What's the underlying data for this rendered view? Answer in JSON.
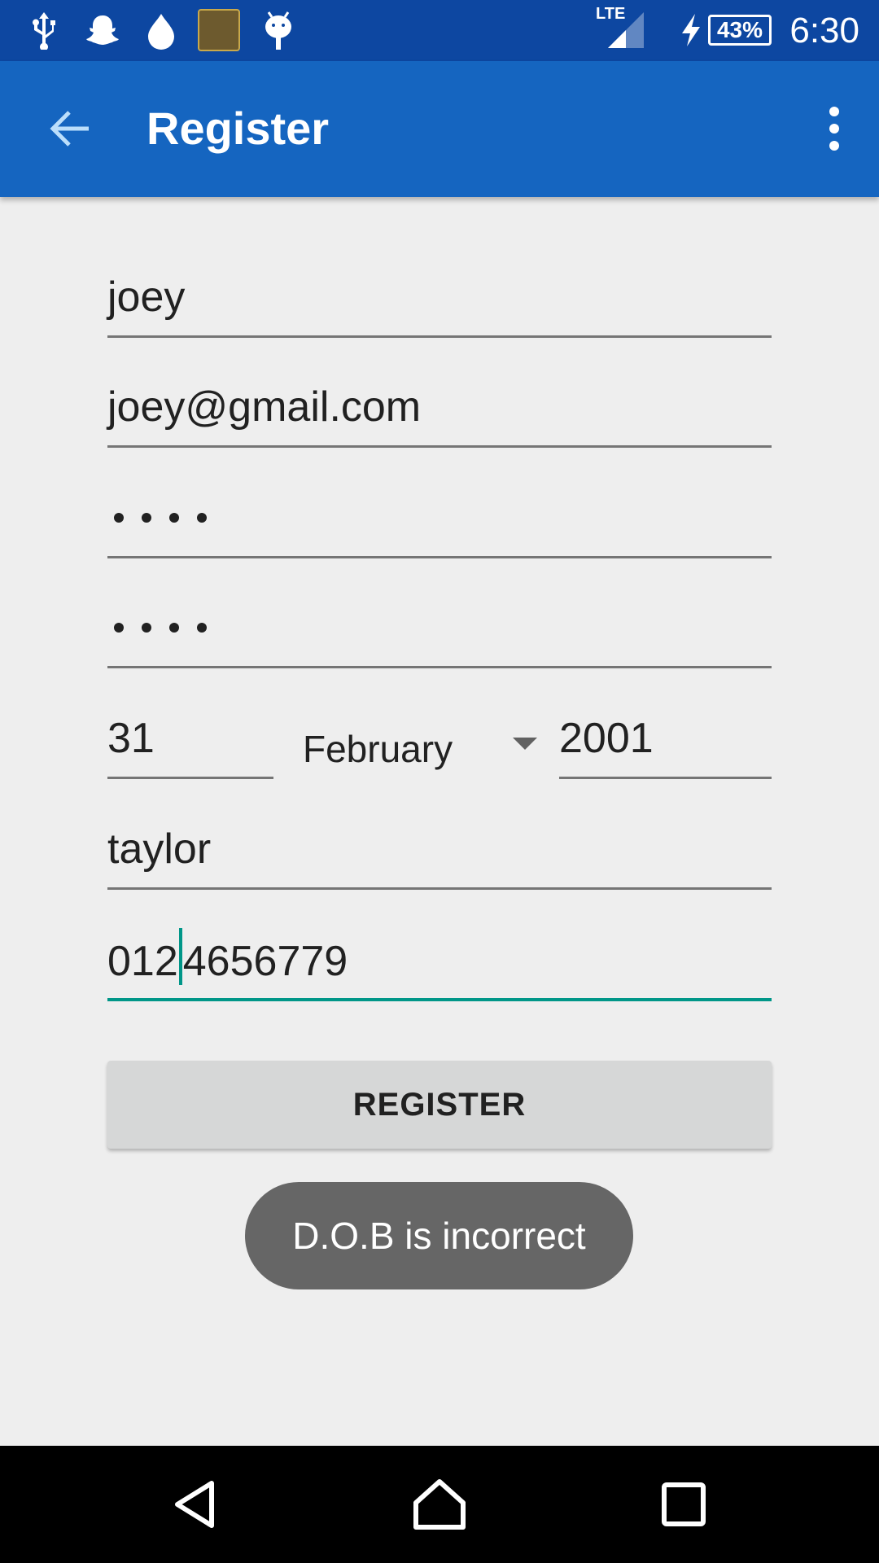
{
  "status_bar": {
    "time": "6:30",
    "battery": "43%",
    "network": "LTE",
    "icons": [
      "usb-icon",
      "snapchat-icon",
      "drop-icon",
      "game-app-icon",
      "android-debug-icon",
      "signal-icon",
      "charging-icon",
      "battery-icon"
    ]
  },
  "app_bar": {
    "title": "Register",
    "back_icon": "arrow-back-icon",
    "menu_icon": "overflow-menu-icon"
  },
  "form": {
    "name": "joey",
    "email": "joey@gmail.com",
    "password_dots": 4,
    "confirm_password_dots": 4,
    "dob_day": "31",
    "dob_month": "February",
    "dob_year": "2001",
    "surname": "taylor",
    "phone_before_cursor": "012",
    "phone_after_cursor": "4656779"
  },
  "register_button": "REGISTER",
  "toast": "D.O.B is incorrect",
  "colors": {
    "status_bar": "#0d47a1",
    "app_bar": "#1565c0",
    "accent": "#009688",
    "background": "#eeeeee"
  }
}
